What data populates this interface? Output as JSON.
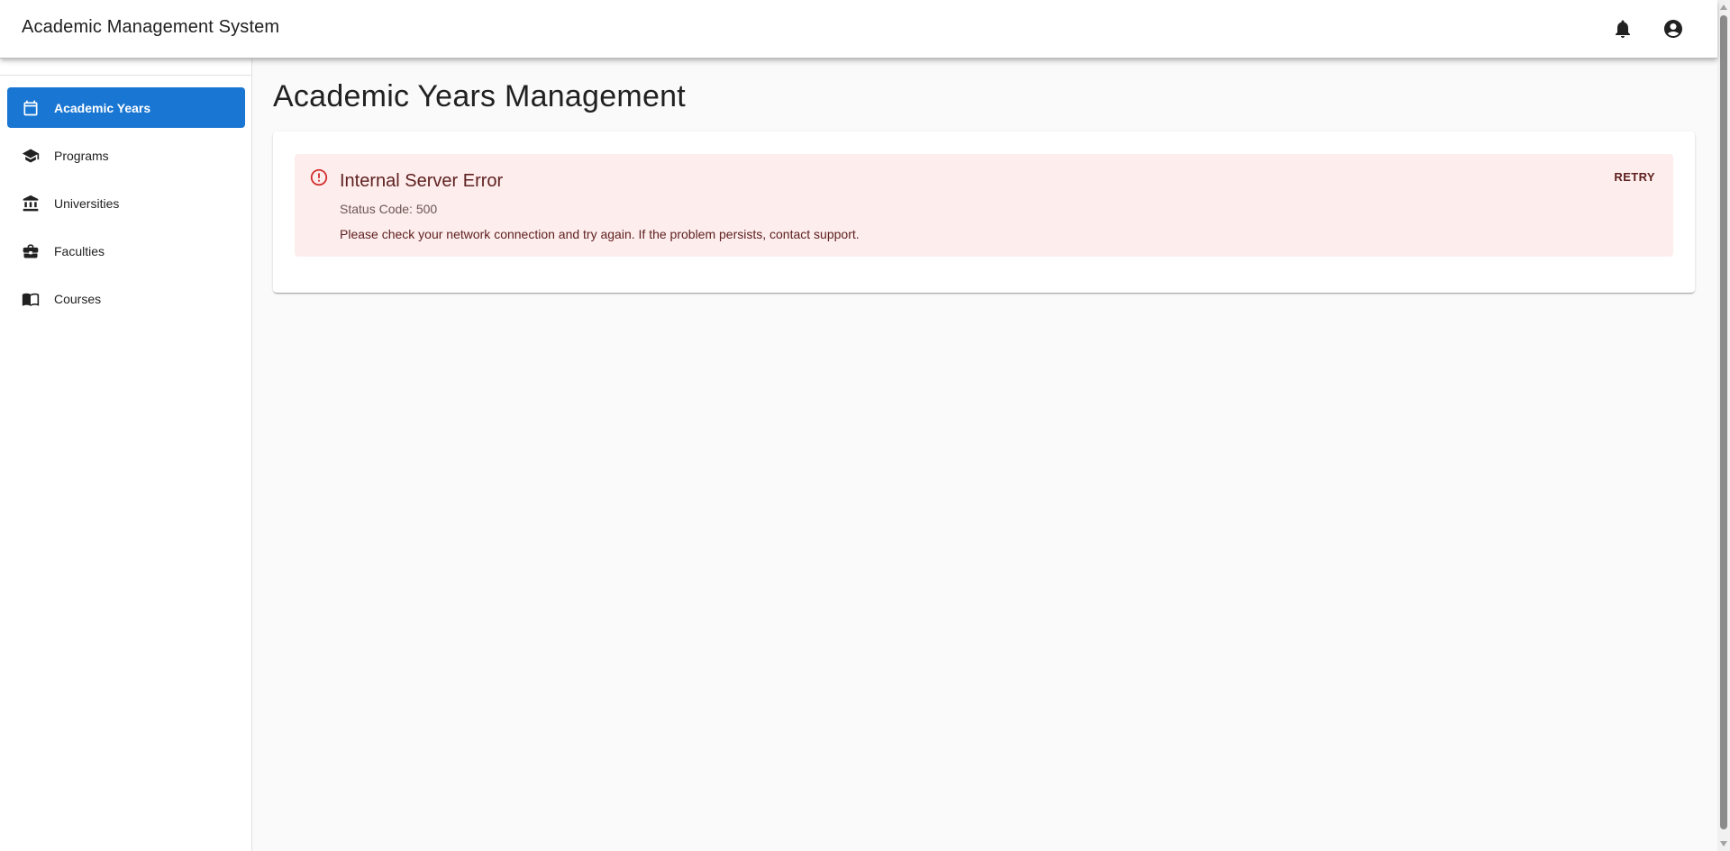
{
  "app": {
    "title": "Academic Management System",
    "accent_color": "#1976d2",
    "notification_icon": "bell-icon",
    "account_icon": "account-circle-icon"
  },
  "sidebar": {
    "items": [
      {
        "label": "Academic Years",
        "icon": "calendar-icon",
        "active": true
      },
      {
        "label": "Programs",
        "icon": "school-icon",
        "active": false
      },
      {
        "label": "Universities",
        "icon": "account-balance-icon",
        "active": false
      },
      {
        "label": "Faculties",
        "icon": "work-icon",
        "active": false
      },
      {
        "label": "Courses",
        "icon": "menu-book-icon",
        "active": false
      }
    ]
  },
  "main": {
    "page_title": "Academic Years Management",
    "error": {
      "icon": "error-outline-icon",
      "title": "Internal Server Error",
      "status": "Status Code: 500",
      "message": "Please check your network connection and try again. If the problem persists, contact support.",
      "retry_label": "RETRY",
      "background_color": "#fdeded",
      "icon_color": "#d32f2f"
    }
  }
}
